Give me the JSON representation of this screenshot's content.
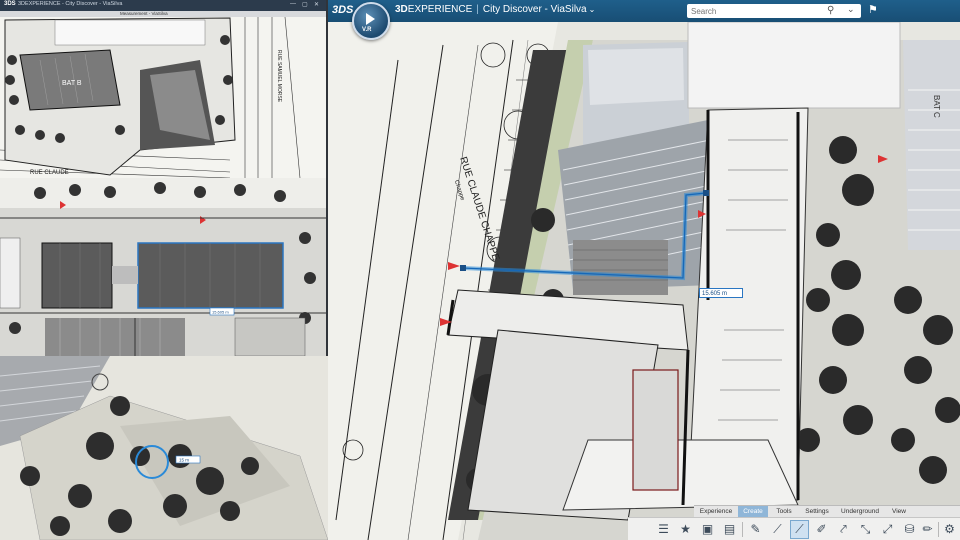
{
  "app": {
    "brand_prefix": "3D",
    "brand_name": "EXPERIENCE",
    "separator": "|",
    "app_title": "City Discover - ViaSilva",
    "title_chevron": "⌄",
    "logo_text": "3DS",
    "compass_label": "V.R"
  },
  "search": {
    "placeholder": "Search",
    "icon": "search-icon",
    "dropdown": "⌄"
  },
  "header_icons": {
    "tag": "tag-icon"
  },
  "tabs": [
    {
      "label": "Experience",
      "active": false
    },
    {
      "label": "Create",
      "active": true
    },
    {
      "label": "Tools",
      "active": false
    },
    {
      "label": "Settings",
      "active": false
    },
    {
      "label": "Underground",
      "active": false
    },
    {
      "label": "View",
      "active": false
    }
  ],
  "toolbar": {
    "buttons": [
      {
        "icon": "layers-list-icon",
        "glyph": "☰"
      },
      {
        "icon": "star-panel-icon",
        "glyph": "★"
      },
      {
        "icon": "image-panel-icon",
        "glyph": "▣"
      },
      {
        "icon": "table-panel-icon",
        "glyph": "▤"
      },
      {
        "icon": "pencil-icon",
        "glyph": "✎"
      },
      {
        "icon": "polyline-icon",
        "glyph": "⟋"
      },
      {
        "icon": "measure-line-icon",
        "glyph": "⟋",
        "active": true
      },
      {
        "icon": "brush-icon",
        "glyph": "✐"
      },
      {
        "icon": "path-icon",
        "glyph": "⤤"
      },
      {
        "icon": "connector-icon",
        "glyph": "⤡"
      },
      {
        "icon": "node-link-icon",
        "glyph": "⤢"
      },
      {
        "icon": "bucket-icon",
        "glyph": "⛁"
      },
      {
        "icon": "paint-brush-icon",
        "glyph": "✏"
      },
      {
        "icon": "layers-stack-icon",
        "glyph": "⧉"
      },
      {
        "icon": "settings-gear-icon",
        "glyph": "⚙"
      }
    ]
  },
  "plan": {
    "street_main": "RUE CLAUDE CHAPPE",
    "street_sub": "Chappe",
    "building_label": "BAT C",
    "measurement": "15.605 m"
  },
  "panel_a": {
    "logo": "3DS",
    "title": "3DEXPERIENCE - City Discover - ViaSilva",
    "tab": "Measurement - ViaSilva",
    "building_label": "BAT B",
    "street_label": "RUE CLAUDE",
    "street_vertical": "RUE SAMUEL MORSE",
    "controls": [
      "—",
      "▢",
      "✕"
    ]
  },
  "panel_b": {
    "measurement": "15.605 m"
  },
  "panel_c": {
    "measurement": "15 m"
  },
  "colors": {
    "header": "#1d5a84",
    "measure_line": "#2a8ad8",
    "selection": "#2a76c2",
    "active_tab": "#8fb6d8"
  }
}
